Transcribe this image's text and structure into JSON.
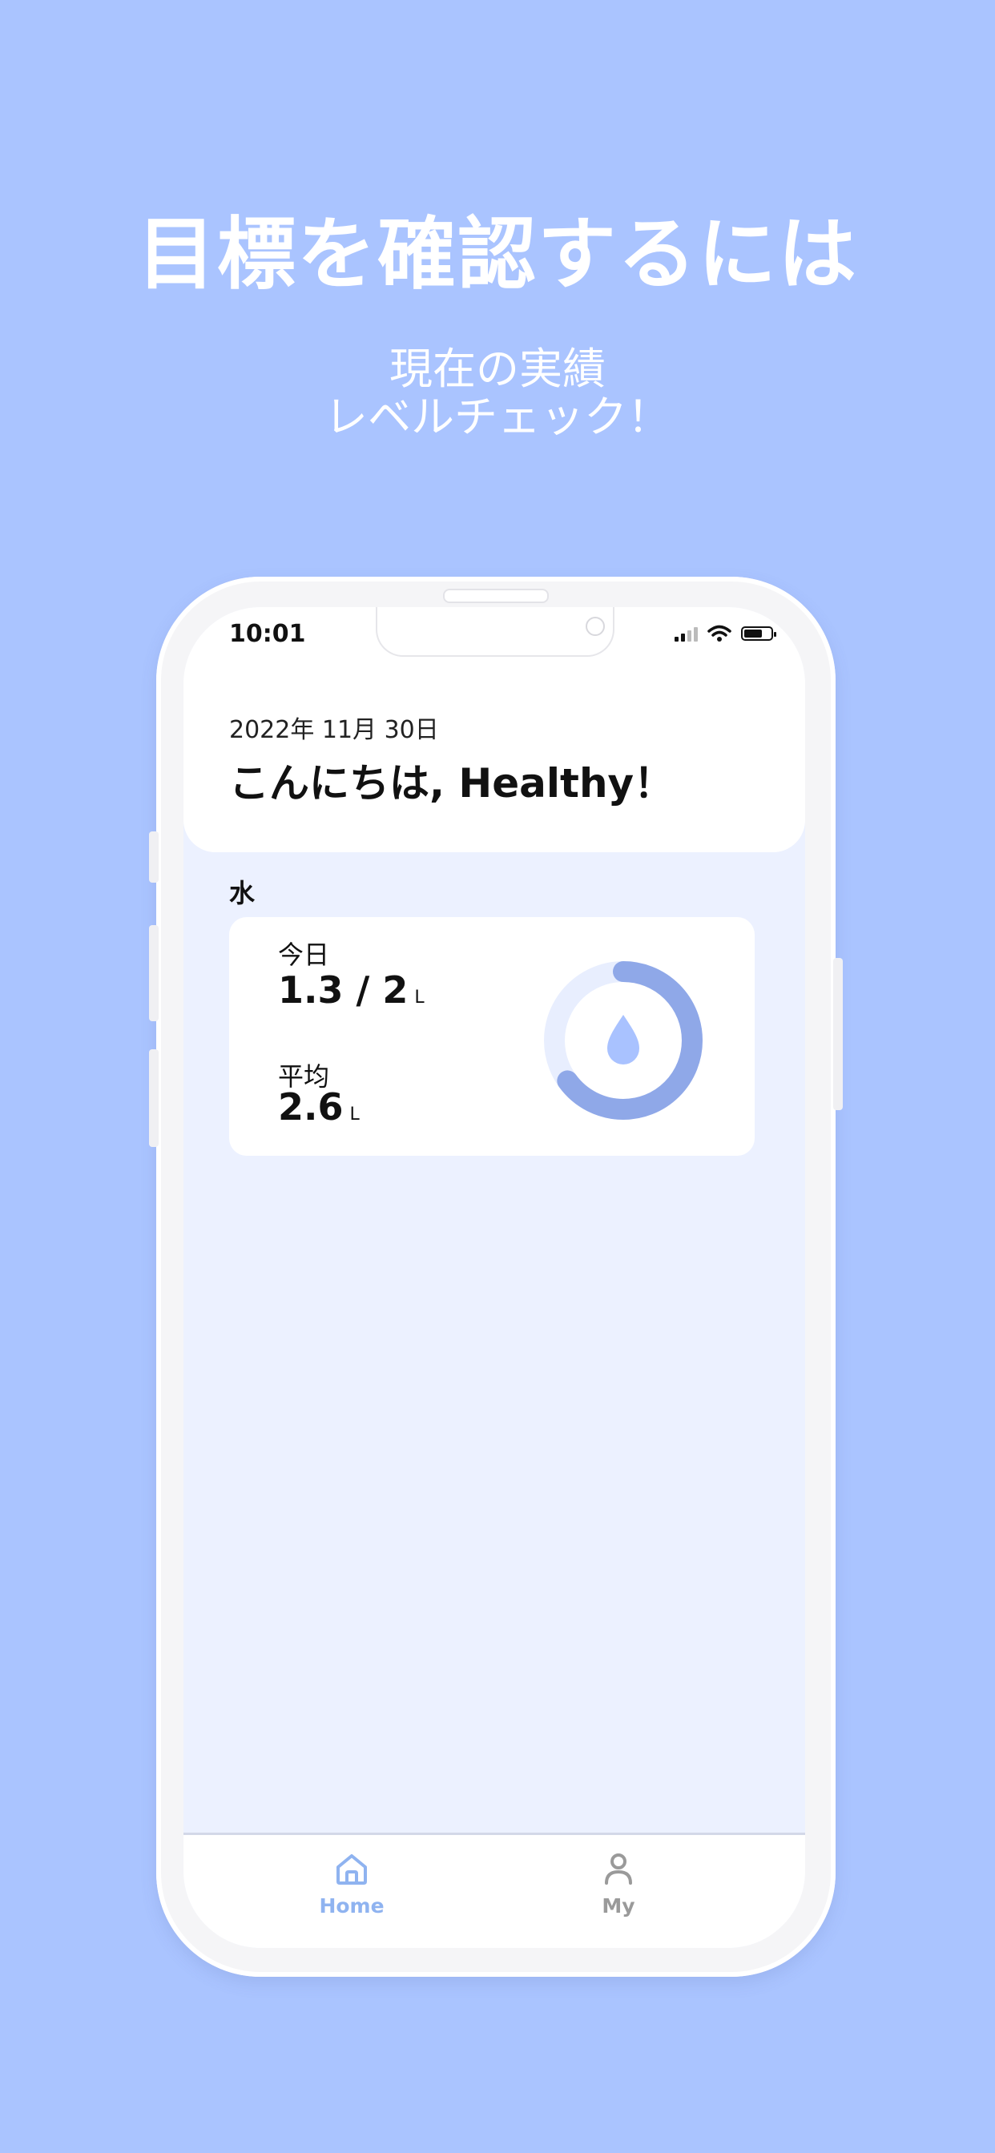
{
  "promo": {
    "headline": "目標を確認するには",
    "subline1": "現在の実績",
    "subline2": "レベルチェック！"
  },
  "status_bar": {
    "time": "10:01"
  },
  "header": {
    "date": "2022年 11月 30日",
    "greeting": "こんにちは, Healthy！"
  },
  "water": {
    "section_label": "水",
    "today_label": "今日",
    "today_value": "1.3 / 2",
    "today_unit": "L",
    "average_label": "平均",
    "average_value": "2.6",
    "average_unit": "L",
    "progress_fraction": 0.65,
    "icon": "water-drop-icon"
  },
  "tabbar": {
    "home_label": "Home",
    "my_label": "My"
  },
  "colors": {
    "background": "#aac4ff",
    "screen_bg": "#ecf1ff",
    "accent": "#8fa8e8",
    "ring_track": "#e8eefe",
    "active_tab": "#8fb3f0",
    "inactive_tab": "#9a9a9a"
  }
}
